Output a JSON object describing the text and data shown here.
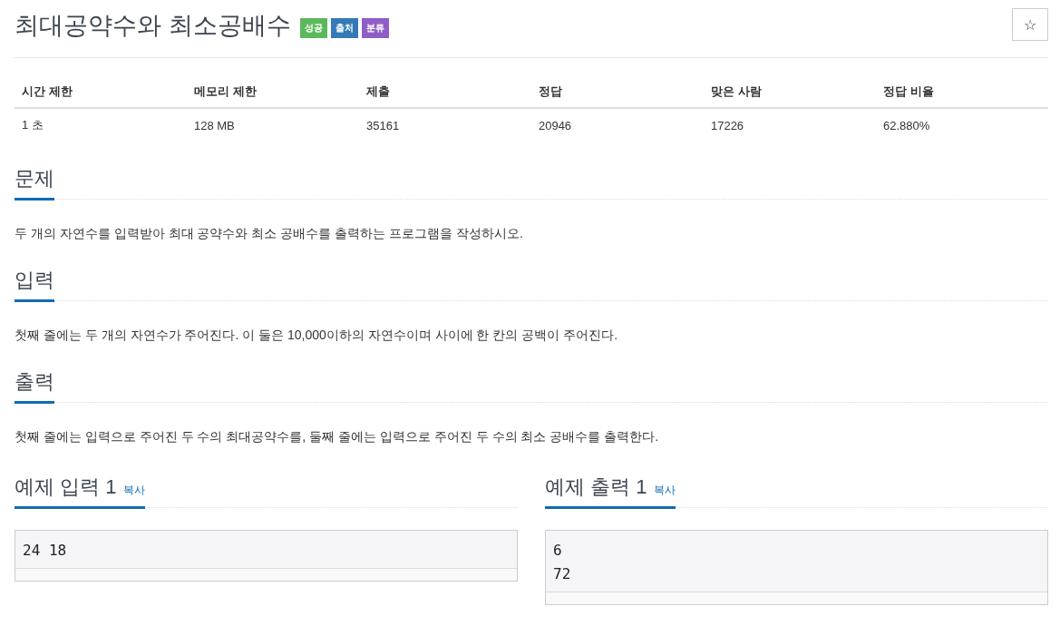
{
  "problem": {
    "title": "최대공약수와 최소공배수",
    "labels": [
      {
        "text": "성공",
        "color": "#5cb85c"
      },
      {
        "text": "출처",
        "color": "#337ab7"
      },
      {
        "text": "분류",
        "color": "#8e5ec6"
      }
    ],
    "star_button": "☆"
  },
  "info_table": {
    "columns": [
      "시간 제한",
      "메모리 제한",
      "제출",
      "정답",
      "맞은 사람",
      "정답 비율"
    ],
    "rows": [
      [
        "1 초",
        "128 MB",
        "35161",
        "20946",
        "17226",
        "62.880%"
      ]
    ]
  },
  "sections": [
    {
      "heading": "문제",
      "text": "두 개의 자연수를 입력받아 최대 공약수와 최소 공배수를 출력하는 프로그램을 작성하시오."
    },
    {
      "heading": "입력",
      "text": "첫째 줄에는 두 개의 자연수가 주어진다. 이 둘은 10,000이하의 자연수이며 사이에 한 칸의 공백이 주어진다."
    },
    {
      "heading": "출력",
      "text": "첫째 줄에는 입력으로 주어진 두 수의 최대공약수를, 둘째 줄에는 입력으로 주어진 두 수의 최소 공배수를 출력한다."
    }
  ],
  "samples": [
    {
      "heading": "예제 입력 1",
      "copy": "복사",
      "lines": [
        "24 18"
      ]
    },
    {
      "heading": "예제 출력 1",
      "copy": "복사",
      "lines": [
        "6",
        "72"
      ]
    }
  ]
}
